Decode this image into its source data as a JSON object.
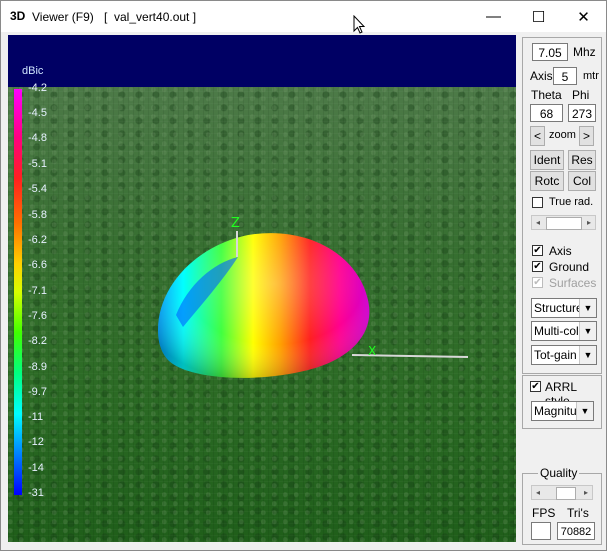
{
  "window": {
    "app_icon": "3D",
    "title": "Viewer (F9)",
    "file": "[  val_vert40.out ]",
    "minimize_symbol": "—",
    "maximize_symbol": "☐",
    "close_symbol": "✕"
  },
  "viewport": {
    "scale_label": "dBic",
    "scale_ticks": [
      "-4.2",
      "-4.5",
      "-4.8",
      "-5.1",
      "-5.4",
      "-5.8",
      "-6.2",
      "-6.6",
      "-7.1",
      "-7.6",
      "-8.2",
      "-8.9",
      "-9.7",
      "-11",
      "-12",
      "-14",
      "-31"
    ],
    "axis_z_label": "Z",
    "axis_x_label": "X"
  },
  "controls": {
    "frequency": {
      "value": "7.05",
      "unit": "Mhz"
    },
    "axis": {
      "label": "Axis",
      "value": "5",
      "unit": "mtr"
    },
    "theta": {
      "label": "Theta",
      "value": "68"
    },
    "phi": {
      "label": "Phi",
      "value": "273"
    },
    "zoom": {
      "left": "<",
      "label": "zoom",
      "right": ">"
    },
    "buttons": {
      "ident": "Ident",
      "res": "Res",
      "rotc": "Rotc",
      "col": "Col"
    },
    "true_rad": {
      "label": "True rad.",
      "checked": false
    },
    "axis_check": {
      "label": "Axis",
      "checked": true
    },
    "ground_check": {
      "label": "Ground",
      "checked": true
    },
    "surfaces_check": {
      "label": "Surfaces",
      "checked": true,
      "disabled": true
    },
    "structure_select": "Structure",
    "color_select": "Multi-colo",
    "gain_select": "Tot-gain",
    "arrl_style": {
      "label": "ARRL style",
      "checked": true
    },
    "magnitude_select": "Magnituc",
    "quality": {
      "label": "Quality"
    },
    "fps": {
      "label": "FPS",
      "value": ""
    },
    "tris": {
      "label": "Tri's",
      "value": "70882"
    }
  }
}
